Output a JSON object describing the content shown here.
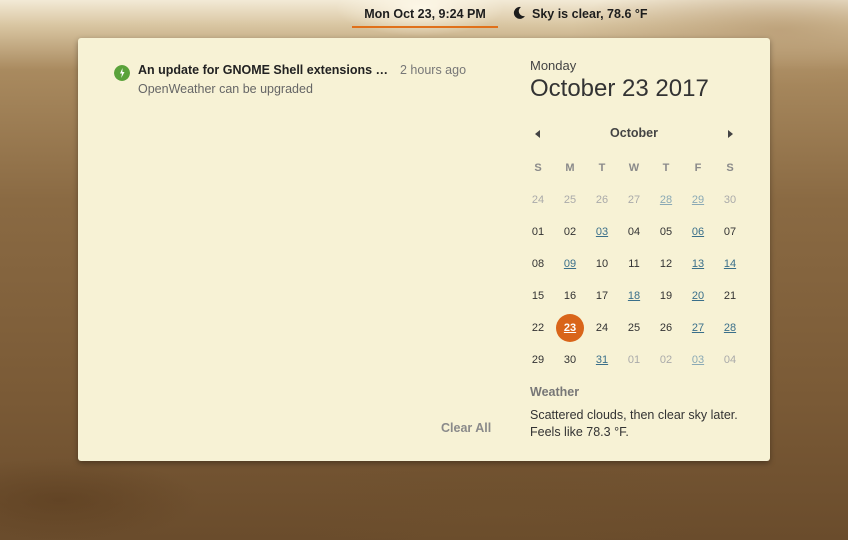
{
  "topbar": {
    "clock": "Mon Oct 23,  9:24 PM",
    "weather_indicator": "Sky is clear, 78.6 °F",
    "moon_icon": "moon-icon"
  },
  "notification": {
    "icon": "update-icon",
    "title": "An update for GNOME Shell extensions a...",
    "time": "2 hours ago",
    "body": "OpenWeather can be upgraded",
    "clear_all": "Clear All"
  },
  "calendar": {
    "day_name": "Monday",
    "date": "October 23 2017",
    "month": "October",
    "weekdays": [
      "S",
      "M",
      "T",
      "W",
      "T",
      "F",
      "S"
    ],
    "weeks": [
      [
        {
          "d": "24",
          "o": true
        },
        {
          "d": "25",
          "o": true
        },
        {
          "d": "26",
          "o": true
        },
        {
          "d": "27",
          "o": true
        },
        {
          "d": "28",
          "o": true,
          "e": true
        },
        {
          "d": "29",
          "o": true,
          "e": true
        },
        {
          "d": "30",
          "o": true
        }
      ],
      [
        {
          "d": "01"
        },
        {
          "d": "02"
        },
        {
          "d": "03",
          "e": true
        },
        {
          "d": "04"
        },
        {
          "d": "05"
        },
        {
          "d": "06",
          "e": true
        },
        {
          "d": "07"
        }
      ],
      [
        {
          "d": "08"
        },
        {
          "d": "09",
          "e": true
        },
        {
          "d": "10"
        },
        {
          "d": "11"
        },
        {
          "d": "12"
        },
        {
          "d": "13",
          "e": true
        },
        {
          "d": "14",
          "e": true
        }
      ],
      [
        {
          "d": "15"
        },
        {
          "d": "16"
        },
        {
          "d": "17"
        },
        {
          "d": "18",
          "e": true
        },
        {
          "d": "19"
        },
        {
          "d": "20",
          "e": true
        },
        {
          "d": "21"
        }
      ],
      [
        {
          "d": "22"
        },
        {
          "d": "23",
          "t": true,
          "e": true
        },
        {
          "d": "24"
        },
        {
          "d": "25"
        },
        {
          "d": "26"
        },
        {
          "d": "27",
          "e": true
        },
        {
          "d": "28",
          "e": true
        }
      ],
      [
        {
          "d": "29"
        },
        {
          "d": "30"
        },
        {
          "d": "31",
          "e": true
        },
        {
          "d": "01",
          "o": true
        },
        {
          "d": "02",
          "o": true
        },
        {
          "d": "03",
          "o": true,
          "e": true
        },
        {
          "d": "04",
          "o": true
        }
      ]
    ]
  },
  "weather": {
    "label": "Weather",
    "text": "Scattered clouds, then clear sky later. Feels like 78.3 °F."
  },
  "colors": {
    "accent": "#d9651a",
    "popover_bg": "#f7f2d5",
    "event_link": "#3a6f8a"
  }
}
